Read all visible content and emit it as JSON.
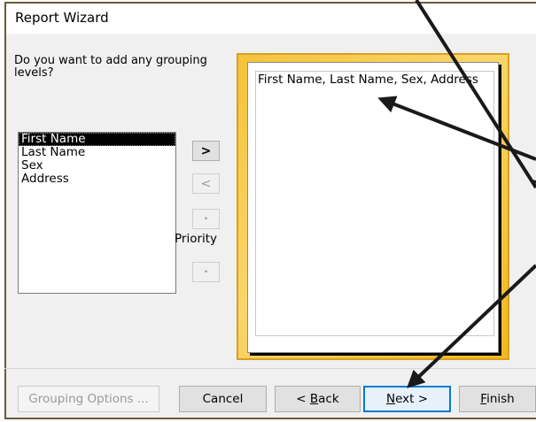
{
  "window": {
    "title": "Report Wizard"
  },
  "prompt": {
    "question": "Do you want to add any grouping\nlevels?"
  },
  "field_list": {
    "items": [
      {
        "label": "First Name",
        "selected": true
      },
      {
        "label": "Last Name",
        "selected": false
      },
      {
        "label": "Sex",
        "selected": false
      },
      {
        "label": "Address",
        "selected": false
      }
    ]
  },
  "move_buttons": {
    "add_label": ">",
    "remove_label": "<",
    "priority_up_glyph": "•",
    "priority_down_glyph": "•",
    "priority_label": "Priority"
  },
  "preview": {
    "text": "First Name, Last Name, Sex, Address"
  },
  "footer": {
    "grouping_options_label": "Grouping Options ...",
    "cancel_label": "Cancel",
    "back_label": "< Back",
    "next_label": "Next >",
    "finish_label": "Finish"
  },
  "colors": {
    "preview_frame": "#f5c33a",
    "default_button_border": "#0078d7",
    "annotation_arrows": "#1a1a1a"
  }
}
